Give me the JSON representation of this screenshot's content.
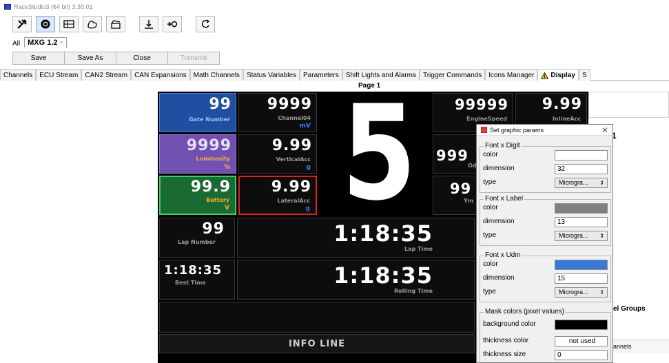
{
  "window": {
    "title": "RaceStudio3 (64 bit) 3.30.01"
  },
  "toolbar": {
    "icons": [
      "tools-icon",
      "settings-icon",
      "dashboard-icon",
      "tracks-icon",
      "clapper-icon",
      "download-icon",
      "connect-icon",
      "refresh-icon"
    ]
  },
  "doc_tabs": {
    "all": "All",
    "active": "MXG 1.2",
    "close_glyph": "✕"
  },
  "actions": {
    "save": "Save",
    "save_as": "Save As",
    "close": "Close",
    "transmit": "Transmit"
  },
  "config_tabs": [
    "Channels",
    "ECU Stream",
    "CAN2 Stream",
    "CAN Expansions",
    "Math Channels",
    "Status Variables",
    "Parameters",
    "Shift Lights and Alarms",
    "Trigger Commands",
    "Icons Manager",
    "Display",
    "S"
  ],
  "page_label": "Page 1",
  "dash": {
    "gear": "5",
    "gate_number": {
      "value": "99",
      "label": "Gate Number"
    },
    "luminosity": {
      "value": "9999",
      "label": "Luminosity",
      "udm": "%"
    },
    "battery": {
      "value": "99.9",
      "label": "Battery",
      "udm": "V"
    },
    "channel04": {
      "value": "9999",
      "label": "Channel04",
      "udm": "mV"
    },
    "vertical_acc": {
      "value": "9.99",
      "label": "VerticalAcc",
      "udm": "g"
    },
    "lateral_acc": {
      "value": "9.99",
      "label": "LateralAcc",
      "udm": "g"
    },
    "engine_speed": {
      "value": "99999",
      "label": "EngineSpeed"
    },
    "inline_acc": {
      "value": "9.99",
      "label": "InlineAcc"
    },
    "odo": {
      "value": "999",
      "label": "Odo"
    },
    "yaw": {
      "value": "99",
      "label": "Ym"
    },
    "lap_number": {
      "value": "99",
      "label": "Lap Number"
    },
    "lap_time": {
      "value": "1:18:35",
      "label": "Lap Time"
    },
    "best_time": {
      "value": "1:18:35",
      "label": "Best Time"
    },
    "rolling_time": {
      "value": "1:18:35",
      "label": "Rolling Time"
    },
    "info_line": "INFO LINE"
  },
  "side_panel": {
    "number": "1",
    "groups_label": "el Groups",
    "channels_label": "annels"
  },
  "dialog": {
    "title": "Set graphic params",
    "close_glyph": "✕",
    "font_digit": {
      "title": "Font x Digit",
      "color_label": "color",
      "dimension_label": "dimension",
      "dimension": "32",
      "type_label": "type",
      "type": "Microgra...",
      "color": "#ffffff"
    },
    "font_label": {
      "title": "Font x Label",
      "color_label": "color",
      "dimension_label": "dimension",
      "dimension": "13",
      "type_label": "type",
      "type": "Microgra...",
      "color": "#808080"
    },
    "font_udm": {
      "title": "Font x Udm",
      "color_label": "color",
      "dimension_label": "dimension",
      "dimension": "15",
      "type_label": "type",
      "type": "Microgra...",
      "color": "#3a78d6"
    },
    "mask": {
      "title": "Mask colors (pixel values)",
      "background_label": "background color",
      "background": "#000000",
      "thickness_color_label": "thickness color",
      "thickness_color": "not used",
      "thickness_size_label": "thickness size",
      "thickness_size": "0"
    }
  },
  "colors": {
    "gate_bg": "#1f4fa0",
    "luminosity_bg": "#7050b0",
    "battery_bg": "#1a6a34",
    "battery_border": "#3fcf66",
    "lateral_border": "#e02020"
  }
}
